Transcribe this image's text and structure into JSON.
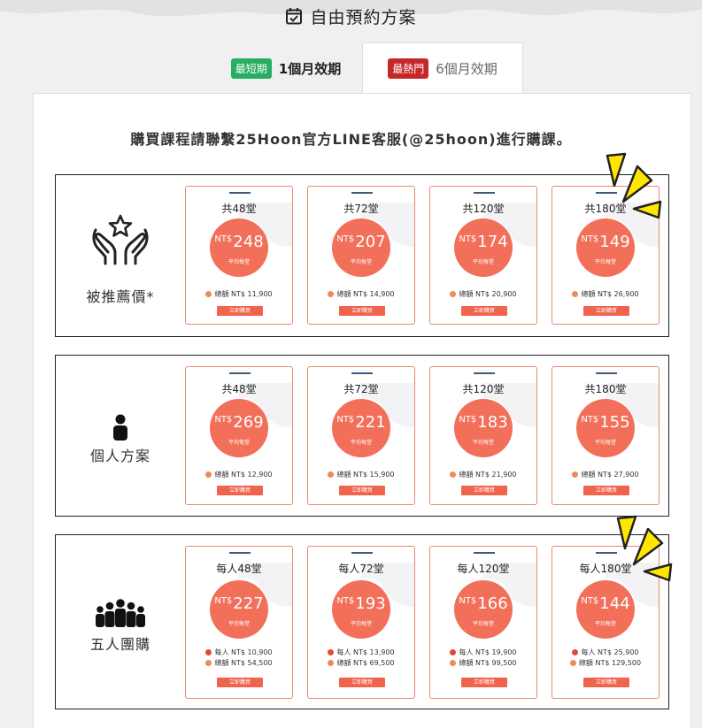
{
  "header": {
    "title": "自由預約方案"
  },
  "tabs": [
    {
      "badge": "最短期",
      "label": "1個月效期"
    },
    {
      "badge": "最熱門",
      "label": "6個月效期"
    }
  ],
  "notice": "購買課程請聯繫25Hoon官方LINE客服(@25hoon)進行購課。",
  "currency": "NT$",
  "per_label": "平均每堂",
  "buy_label": "立即購買",
  "colors": {
    "accent": "#f2705a",
    "green_badge": "#27ae60",
    "red_badge": "#c62828"
  },
  "plans": [
    {
      "label": "被推薦價*",
      "icon": "hands-star-icon",
      "cards": [
        {
          "count": "共48堂",
          "price": "248",
          "total": "總額 NT$ 11,900"
        },
        {
          "count": "共72堂",
          "price": "207",
          "total": "總額 NT$ 14,900"
        },
        {
          "count": "共120堂",
          "price": "174",
          "total": "總額 NT$ 20,900"
        },
        {
          "count": "共180堂",
          "price": "149",
          "total": "總額 NT$ 26,900"
        }
      ]
    },
    {
      "label": "個人方案",
      "icon": "person-icon",
      "cards": [
        {
          "count": "共48堂",
          "price": "269",
          "total": "總額 NT$ 12,900"
        },
        {
          "count": "共72堂",
          "price": "221",
          "total": "總額 NT$ 15,900"
        },
        {
          "count": "共120堂",
          "price": "183",
          "total": "總額 NT$ 21,900"
        },
        {
          "count": "共180堂",
          "price": "155",
          "total": "總額 NT$ 27,900"
        }
      ]
    },
    {
      "label": "五人團購",
      "icon": "group-icon",
      "cards": [
        {
          "count": "每人48堂",
          "price": "227",
          "each": "每人 NT$ 10,900",
          "total": "總額 NT$ 54,500"
        },
        {
          "count": "每人72堂",
          "price": "193",
          "each": "每人 NT$ 13,900",
          "total": "總額 NT$ 69,500"
        },
        {
          "count": "每人120堂",
          "price": "166",
          "each": "每人 NT$ 19,900",
          "total": "總額 NT$ 99,500"
        },
        {
          "count": "每人180堂",
          "price": "144",
          "each": "每人 NT$ 25,900",
          "total": "總額 NT$ 129,500"
        }
      ]
    }
  ]
}
